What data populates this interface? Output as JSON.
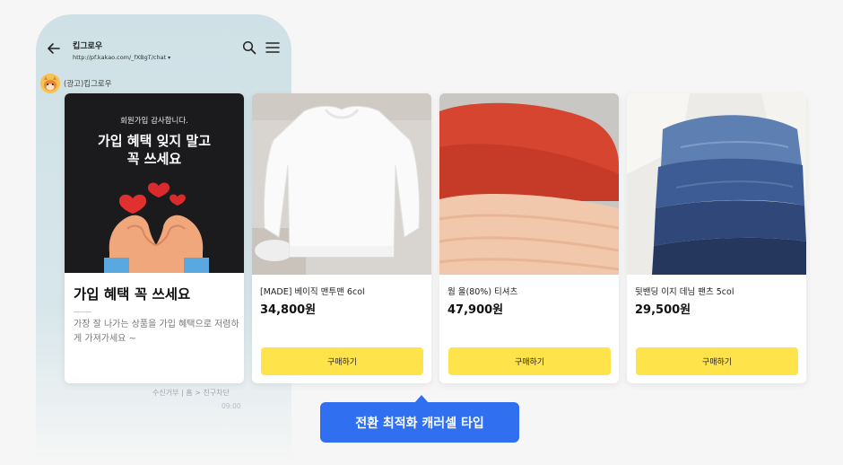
{
  "phone": {
    "chat_title": "킵그로우",
    "chat_url": "http://pf.kakao.com/_fXBgT/chat",
    "url_caret": "▾",
    "sender_name": "(광고)킵그로우",
    "footer_text": "수신거부 | 홈 > 친구차단",
    "footer_time": "09:00"
  },
  "promo": {
    "small_text": "회원가입 감사합니다.",
    "headline_line1": "가입 혜택 잊지 말고",
    "headline_line2": "꼭 쓰세요",
    "title": "가입 혜택 꼭 쓰세요",
    "description": "가장 잘 나가는 상품을 가입 혜택으로 저렴하게 가져가세요 ~"
  },
  "products": [
    {
      "name": "[MADE] 베이직 맨투맨 6col",
      "price": "34,800원",
      "button": "구매하기"
    },
    {
      "name": "웜 울(80%) 티셔츠",
      "price": "47,900원",
      "button": "구매하기"
    },
    {
      "name": "뒷밴딩 이지 데님 팬츠 5col",
      "price": "29,500원",
      "button": "구매하기"
    }
  ],
  "label": "전환 최적화 캐러셀 타입",
  "colors": {
    "accent_yellow": "#fee34a",
    "label_blue": "#2f6ff0",
    "phone_bg": "#cfe1e6"
  },
  "icons": {
    "back": "arrow-left-icon",
    "search": "search-icon",
    "menu": "hamburger-menu-icon"
  }
}
